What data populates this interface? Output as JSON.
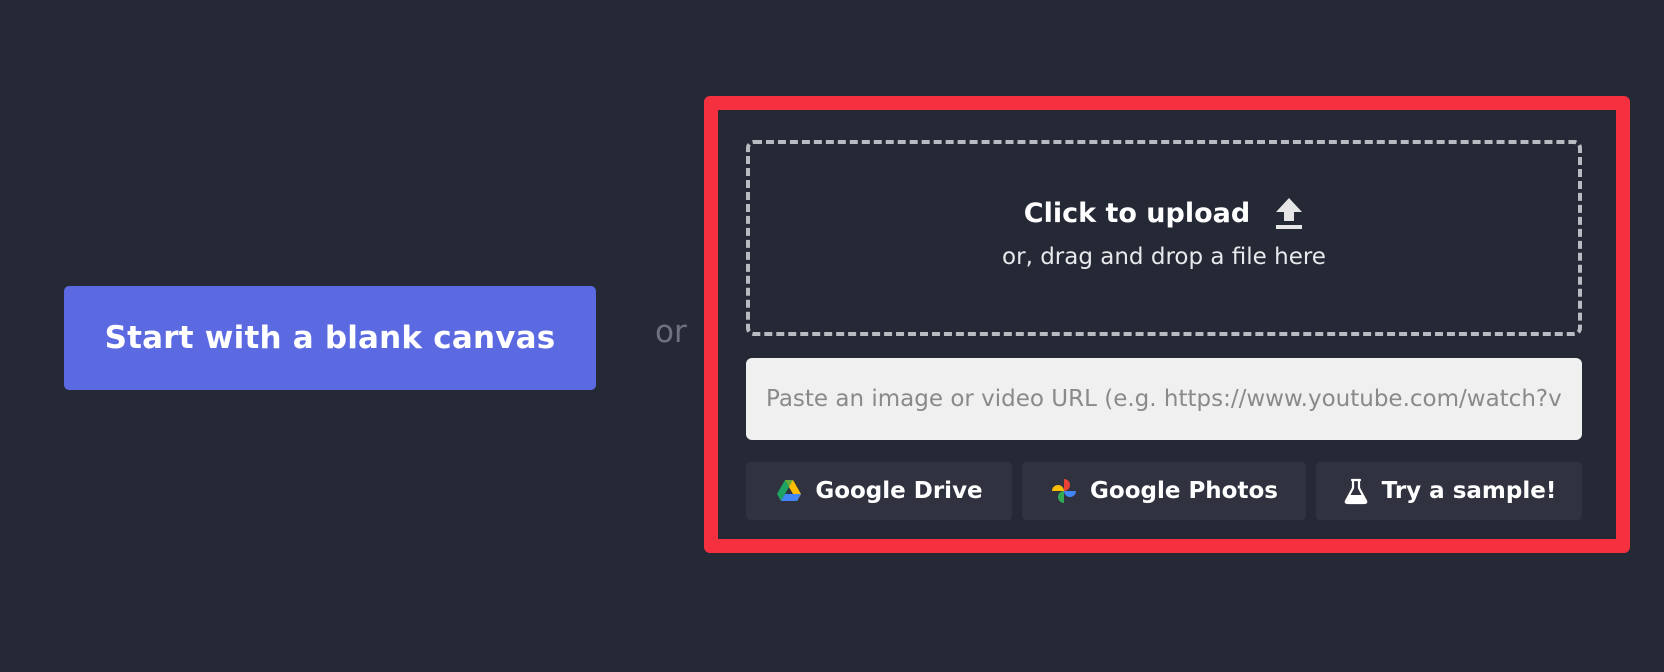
{
  "blank_canvas": {
    "label": "Start with a blank canvas"
  },
  "separator": {
    "text": "or"
  },
  "upload": {
    "title": "Click to upload",
    "subtitle": "or, drag and drop a file here",
    "icon": "upload-icon"
  },
  "url_input": {
    "placeholder": "Paste an image or video URL (e.g. https://www.youtube.com/watch?v=C",
    "value": ""
  },
  "sources": [
    {
      "label": "Google Drive",
      "icon": "google-drive-icon"
    },
    {
      "label": "Google Photos",
      "icon": "google-photos-icon"
    },
    {
      "label": "Try a sample!",
      "icon": "flask-icon"
    }
  ],
  "colors": {
    "background": "#252835",
    "primary_button": "#5b6ae1",
    "highlight_border": "#f5313f",
    "source_button": "#30333f",
    "input_background": "#f0f0f0"
  }
}
